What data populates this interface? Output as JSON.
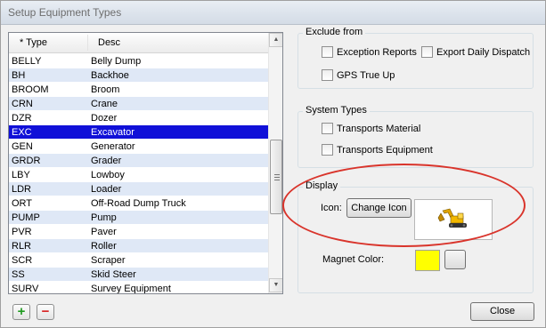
{
  "window": {
    "title": "Setup Equipment Types"
  },
  "list": {
    "columns": {
      "type": "* Type",
      "desc": "Desc"
    },
    "rows": [
      {
        "type": "BELLY",
        "desc": "Belly Dump"
      },
      {
        "type": "BH",
        "desc": "Backhoe"
      },
      {
        "type": "BROOM",
        "desc": "Broom"
      },
      {
        "type": "CRN",
        "desc": "Crane"
      },
      {
        "type": "DZR",
        "desc": "Dozer"
      },
      {
        "type": "EXC",
        "desc": "Excavator"
      },
      {
        "type": "GEN",
        "desc": "Generator"
      },
      {
        "type": "GRDR",
        "desc": "Grader"
      },
      {
        "type": "LBY",
        "desc": "Lowboy"
      },
      {
        "type": "LDR",
        "desc": "Loader"
      },
      {
        "type": "ORT",
        "desc": "Off-Road Dump Truck"
      },
      {
        "type": "PUMP",
        "desc": "Pump"
      },
      {
        "type": "PVR",
        "desc": "Paver"
      },
      {
        "type": "RLR",
        "desc": "Roller"
      },
      {
        "type": "SCR",
        "desc": "Scraper"
      },
      {
        "type": "SS",
        "desc": "Skid Steer"
      },
      {
        "type": "SURV",
        "desc": "Survey Equipment"
      }
    ],
    "selected_type": "EXC"
  },
  "exclude_from": {
    "legend": "Exclude from",
    "exception_reports": "Exception Reports",
    "export_daily_dispatch": "Export Daily Dispatch",
    "gps_true_up": "GPS True Up"
  },
  "system_types": {
    "legend": "System Types",
    "transports_material": "Transports Material",
    "transports_equipment": "Transports Equipment"
  },
  "display": {
    "legend": "Display",
    "icon_label": "Icon:",
    "change_icon_button": "Change Icon",
    "icon_name": "excavator-icon",
    "magnet_color_label": "Magnet Color:",
    "magnet_color": "#ffff00"
  },
  "buttons": {
    "close": "Close"
  }
}
